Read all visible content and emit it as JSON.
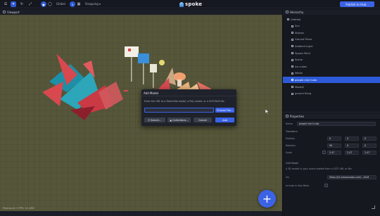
{
  "topbar": {
    "global_label": "Global",
    "snapping_label": "Snapping ▾",
    "app_name": "spoke",
    "publish_label": "Publish to Hub..."
  },
  "viewport": {
    "title": "Viewport",
    "status": "Polycount: 0   FPS: 12.2/60"
  },
  "dialog": {
    "title": "Add Model",
    "description": "Enter the URL to a Sketchfab model, a Poly model, or a GLTF/GLB file.",
    "url_value": "",
    "choose_file_label": "Choose File...",
    "search_label": "Search...",
    "collections_label": "Collections...",
    "cancel_label": "Cancel",
    "add_label": "Add"
  },
  "hierarchy": {
    "title": "Hierarchy",
    "items": [
      {
        "label": "Untitled",
        "selected": false
      },
      {
        "label": "Sun",
        "selected": false
      },
      {
        "label": "Skybox",
        "selected": false
      },
      {
        "label": "Ground Plane",
        "selected": false
      },
      {
        "label": "Ambient Light",
        "selected": false
      },
      {
        "label": "Spawn Point",
        "selected": false
      },
      {
        "label": "Scene",
        "selected": false
      },
      {
        "label": "ice cubes",
        "selected": false
      },
      {
        "label": "Media",
        "selected": false
      },
      {
        "label": "people mini hubs",
        "selected": true
      },
      {
        "label": "Model2",
        "selected": false
      },
      {
        "label": "ground thing",
        "selected": false
      }
    ]
  },
  "properties": {
    "title": "Properties",
    "name_label": "Name",
    "name_value": "people mini hubs",
    "transform_label": "Transform",
    "position_label": "Position",
    "position": [
      "0",
      "0",
      "0"
    ],
    "rotation_label": "Rotation",
    "rotation": [
      "90",
      "0",
      "0"
    ],
    "scale_label": "Scale",
    "scale": [
      "2.47",
      "2.47",
      "2.47"
    ],
    "gltf_section": "GLB Model",
    "gltf_desc": "A 3D model in your scene loaded from a GLTF URL or file.",
    "src_label": "Src",
    "src_value": "https://s3.amazonaws.com/.../GLB",
    "include_label": "Include in Nav Mesh"
  },
  "colors": {
    "accent": "#3b63e6",
    "panel": "#16181f",
    "viewport_ground": "#56563a"
  },
  "icons": [
    "select-icon",
    "move-icon",
    "rotate-icon",
    "scale-icon",
    "globe-icon",
    "magnet-icon",
    "plus-icon",
    "search-icon",
    "collections-icon"
  ]
}
